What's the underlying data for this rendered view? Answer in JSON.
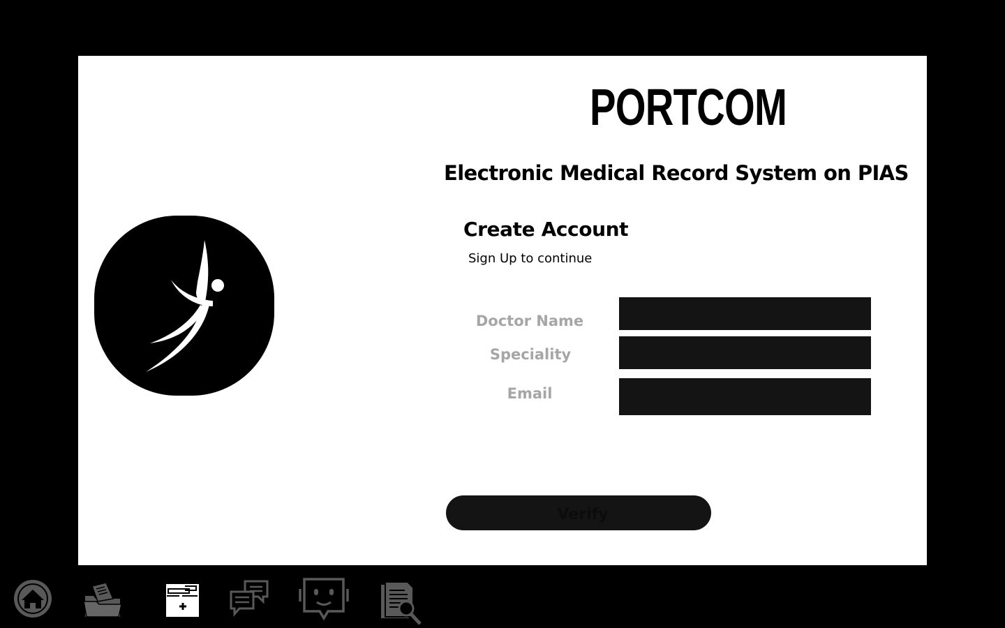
{
  "brand": {
    "name": "PORTCOM",
    "subtitle": "Electronic Medical Record System on PIAS"
  },
  "form": {
    "title": "Create Account",
    "subtitle": "Sign Up to continue",
    "fields": [
      {
        "label": "Doctor Name",
        "value": ""
      },
      {
        "label": "Speciality",
        "value": ""
      },
      {
        "label": "Email",
        "value": ""
      }
    ],
    "submit_label": "Verify"
  },
  "dock": {
    "items": [
      {
        "icon": "home-icon"
      },
      {
        "icon": "folder-icon"
      },
      {
        "icon": "medical-record-icon",
        "active": true
      },
      {
        "icon": "chat-icon"
      },
      {
        "icon": "bot-icon"
      },
      {
        "icon": "document-search-icon"
      }
    ]
  },
  "colors": {
    "background": "#000000",
    "panel": "#ffffff",
    "input_fill": "#141414",
    "label_gray": "#a6a6a6",
    "dock_icon_gray": "#595959"
  }
}
